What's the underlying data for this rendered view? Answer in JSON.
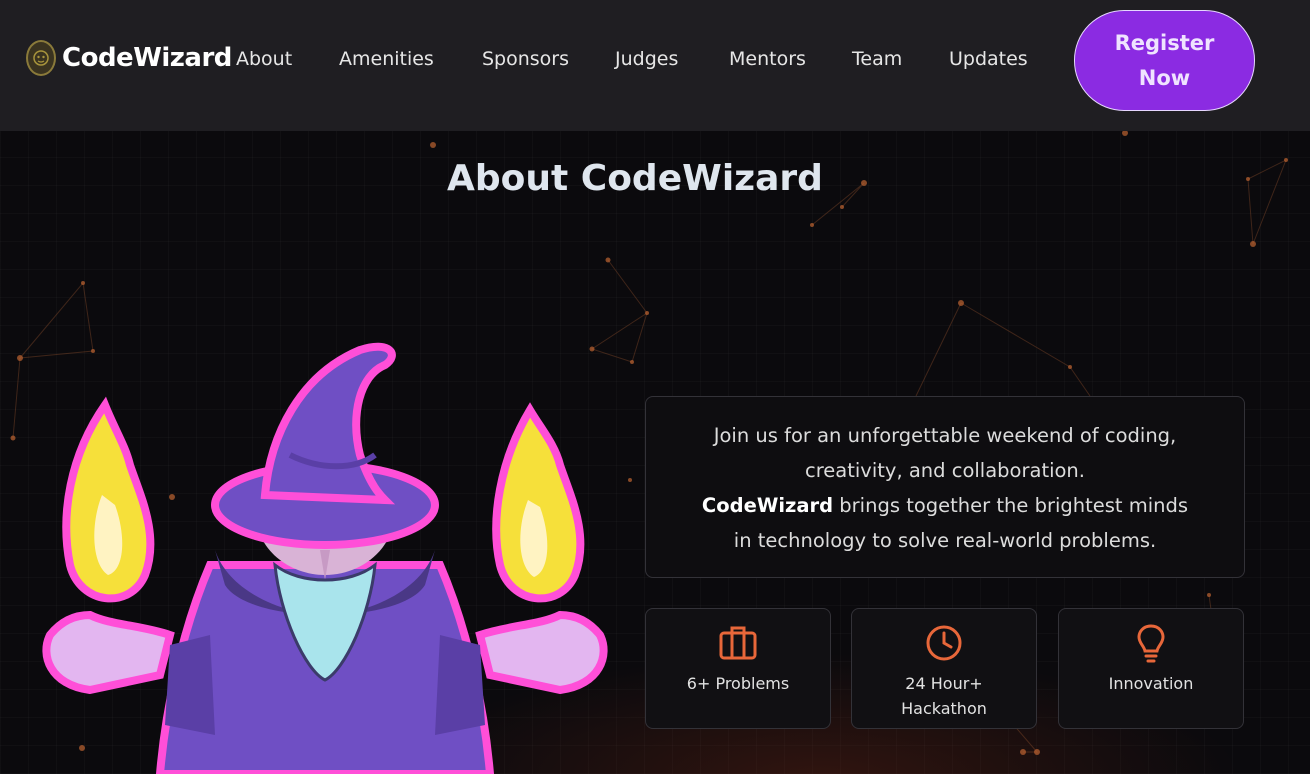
{
  "header": {
    "logo_text": "CodeWizard",
    "nav": [
      "About",
      "Amenities",
      "Sponsors",
      "Judges",
      "Mentors",
      "Team",
      "Updates"
    ],
    "register_label": "Register Now"
  },
  "about": {
    "title": "About CodeWizard",
    "line1": "Join us for an unforgettable weekend of coding,",
    "line2": "creativity, and collaboration.",
    "brand": "CodeWizard",
    "line3_rest": " brings together the brightest minds",
    "line4": "in technology to solve real-world problems."
  },
  "features": [
    {
      "label": "6+ Problems",
      "icon": "briefcase-icon"
    },
    {
      "label": "24 Hour+ Hackathon",
      "icon": "clock-icon"
    },
    {
      "label": "Innovation",
      "icon": "lightbulb-icon"
    }
  ],
  "colors": {
    "accent": "#8b2be2",
    "icon_orange": "#e8673a",
    "header_bg": "#1f1e22"
  }
}
